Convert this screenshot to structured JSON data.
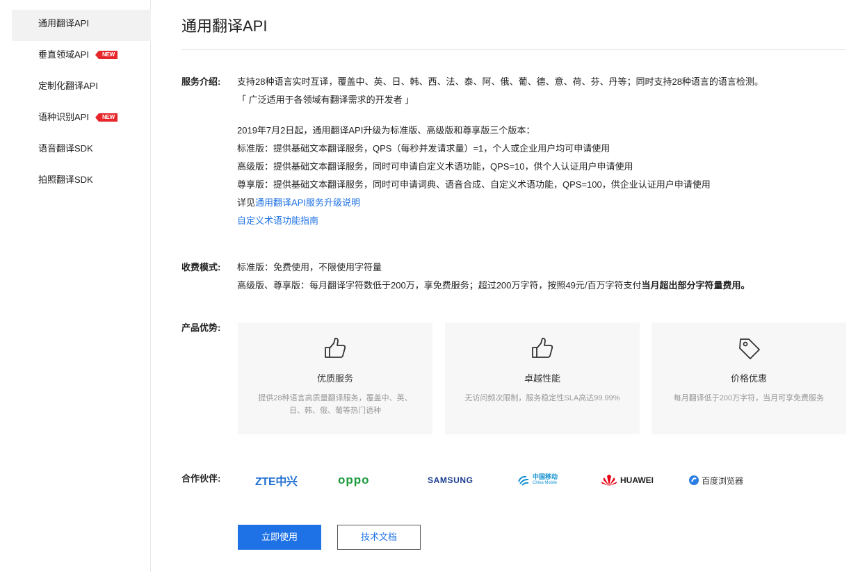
{
  "sidebar": {
    "items": [
      {
        "label": "通用翻译API",
        "tag": ""
      },
      {
        "label": "垂直领域API",
        "tag": "NEW"
      },
      {
        "label": "定制化翻译API",
        "tag": ""
      },
      {
        "label": "语种识别API",
        "tag": "NEW"
      },
      {
        "label": "语音翻译SDK",
        "tag": ""
      },
      {
        "label": "拍照翻译SDK",
        "tag": ""
      }
    ]
  },
  "page": {
    "title": "通用翻译API"
  },
  "intro": {
    "label": "服务介绍:",
    "line1": "支持28种语言实时互译，覆盖中、英、日、韩、西、法、泰、阿、俄、葡、德、意、荷、芬、丹等；同时支持28种语言的语言检测。",
    "line2": "「  广泛适用于各领域有翻译需求的开发者  」",
    "upgrade": "2019年7月2日起，通用翻译API升级为标准版、高级版和尊享版三个版本：",
    "standard": "标准版：提供基础文本翻译服务，QPS（每秒并发请求量）=1，个人或企业用户均可申请使用",
    "advanced": "高级版：提供基础文本翻译服务，同时可申请自定义术语功能，QPS=10，供个人认证用户申请使用",
    "premium": "尊享版：提供基础文本翻译服务，同时可申请词典、语音合成、自定义术语功能，QPS=100，供企业认证用户申请使用",
    "detail_prefix": "详见",
    "detail_link": "通用翻译API服务升级说明",
    "term_link": "自定义术语功能指南"
  },
  "pricing": {
    "label": "收费模式:",
    "line1": "标准版：免费使用，不限使用字符量",
    "line2": "高级版、尊享版：每月翻译字符数低于200万，享免费服务；超过200万字符，按照49元/百万字符支付",
    "line2_bold": "当月超出部分字符量费用。"
  },
  "advantages": {
    "label": "产品优势:",
    "cards": [
      {
        "icon": "thumbs-up-icon",
        "title": "优质服务",
        "desc": "提供28种语言高质量翻译服务，覆盖中、英、日、韩、俄、葡等热门语种"
      },
      {
        "icon": "thumbs-up-icon",
        "title": "卓越性能",
        "desc": "无访问频次限制，服务稳定性SLA高达99.99%"
      },
      {
        "icon": "price-tag-icon",
        "title": "价格优惠",
        "desc": "每月翻译低于200万字符，当月可享免费服务"
      }
    ]
  },
  "partners": {
    "label": "合作伙伴:",
    "logos": {
      "zte": "ZTE中兴",
      "oppo": "oppo",
      "samsung": "SAMSUNG",
      "cmcc_cn": "中国移动",
      "cmcc_en": "China Mobile",
      "huawei": "HUAWEI",
      "baidu": "百度浏览器"
    }
  },
  "actions": {
    "use_now": "立即使用",
    "docs": "技术文档"
  },
  "colors": {
    "accent": "#1f72e5",
    "new_tag": "#e6262a",
    "oppo": "#1a9a3b",
    "zte": "#1f6fd1",
    "huawei": "#e60012"
  }
}
